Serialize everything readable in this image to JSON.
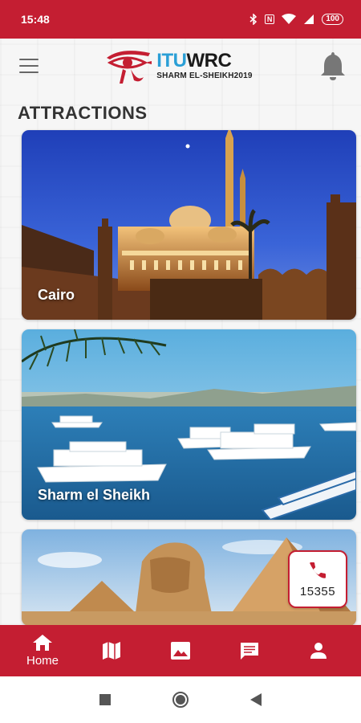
{
  "status": {
    "time": "15:48",
    "battery": "100",
    "nfc": "N"
  },
  "header": {
    "logo_title_itu": "ITU",
    "logo_title_wrc": "WRC",
    "logo_subtitle": "SHARM EL-SHEIKH2019",
    "menu_icon": "menu-icon",
    "bell_icon": "bell-icon"
  },
  "section": {
    "title": "ATTRACTIONS"
  },
  "attractions": [
    {
      "label": "Cairo"
    },
    {
      "label": "Sharm el Sheikh"
    },
    {
      "label": ""
    }
  ],
  "call_fab": {
    "icon": "phone-icon",
    "number": "15355"
  },
  "bottom_nav": {
    "items": [
      {
        "icon": "home-icon",
        "label": "Home",
        "active": true
      },
      {
        "icon": "map-icon",
        "label": ""
      },
      {
        "icon": "gallery-icon",
        "label": ""
      },
      {
        "icon": "chat-icon",
        "label": ""
      },
      {
        "icon": "profile-icon",
        "label": ""
      }
    ]
  },
  "colors": {
    "brand_red": "#c41e32",
    "logo_blue": "#2a9fd6"
  }
}
